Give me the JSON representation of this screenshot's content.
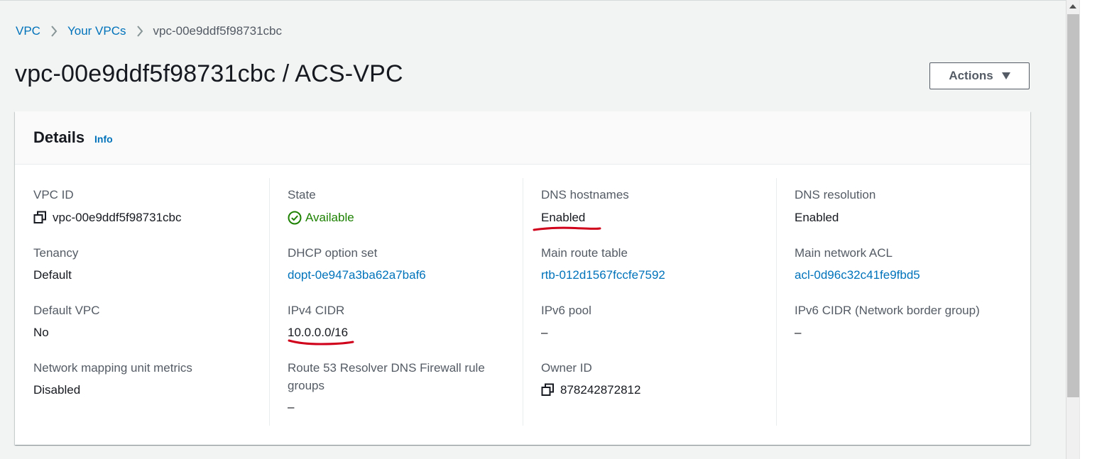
{
  "breadcrumb": {
    "items": [
      "VPC",
      "Your VPCs"
    ],
    "current": "vpc-00e9ddf5f98731cbc"
  },
  "page": {
    "title": "vpc-00e9ddf5f98731cbc / ACS-VPC"
  },
  "actions": {
    "label": "Actions"
  },
  "details": {
    "title": "Details",
    "info": "Info",
    "fields": {
      "vpc_id": {
        "label": "VPC ID",
        "value": "vpc-00e9ddf5f98731cbc"
      },
      "state": {
        "label": "State",
        "value": "Available"
      },
      "dns_hostnames": {
        "label": "DNS hostnames",
        "value": "Enabled"
      },
      "dns_resolution": {
        "label": "DNS resolution",
        "value": "Enabled"
      },
      "tenancy": {
        "label": "Tenancy",
        "value": "Default"
      },
      "dhcp_option_set": {
        "label": "DHCP option set",
        "value": "dopt-0e947a3ba62a7baf6"
      },
      "main_route_table": {
        "label": "Main route table",
        "value": "rtb-012d1567fccfe7592"
      },
      "main_network_acl": {
        "label": "Main network ACL",
        "value": "acl-0d96c32c41fe9fbd5"
      },
      "default_vpc": {
        "label": "Default VPC",
        "value": "No"
      },
      "ipv4_cidr": {
        "label": "IPv4 CIDR",
        "value": "10.0.0.0/16"
      },
      "ipv6_pool": {
        "label": "IPv6 pool",
        "value": "–"
      },
      "ipv6_cidr": {
        "label": "IPv6 CIDR (Network border group)",
        "value": "–"
      },
      "nmu_metrics": {
        "label": "Network mapping unit metrics",
        "value": "Disabled"
      },
      "route53_firewall": {
        "label_line1": "Route 53 Resolver DNS Firewall rule",
        "label_line2": "groups",
        "value": "–"
      },
      "owner_id": {
        "label": "Owner ID",
        "value": "878242872812"
      }
    }
  },
  "colors": {
    "link": "#0073bb",
    "status_ok": "#1d8102",
    "annotation": "#d0021b",
    "page_bg": "#f2f3f3"
  },
  "icons": [
    "chevron-right-icon",
    "caret-down-icon",
    "copy-icon",
    "check-circle-icon"
  ]
}
